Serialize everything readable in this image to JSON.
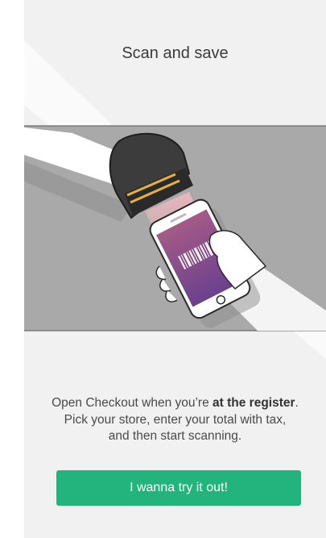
{
  "title": "Scan and save",
  "description": {
    "line1_before": "Open Checkout when you’re ",
    "line1_bold": "at the register",
    "line1_after": ".",
    "line2": "Pick your store, enter your total with tax,",
    "line3": "and then start scanning."
  },
  "cta_label": "I wanna try it out!",
  "colors": {
    "background": "#f1f1f1",
    "panel": "#a9a9a9",
    "accent": "#22b47c",
    "scan_beam": "#e8b23a",
    "phone_screen": "#7e4a8e"
  },
  "illustration": {
    "subject": "hand holding scanner over phone with barcode",
    "icons": [
      "barcode-scanner-icon",
      "smartphone-icon",
      "barcode-icon"
    ]
  }
}
